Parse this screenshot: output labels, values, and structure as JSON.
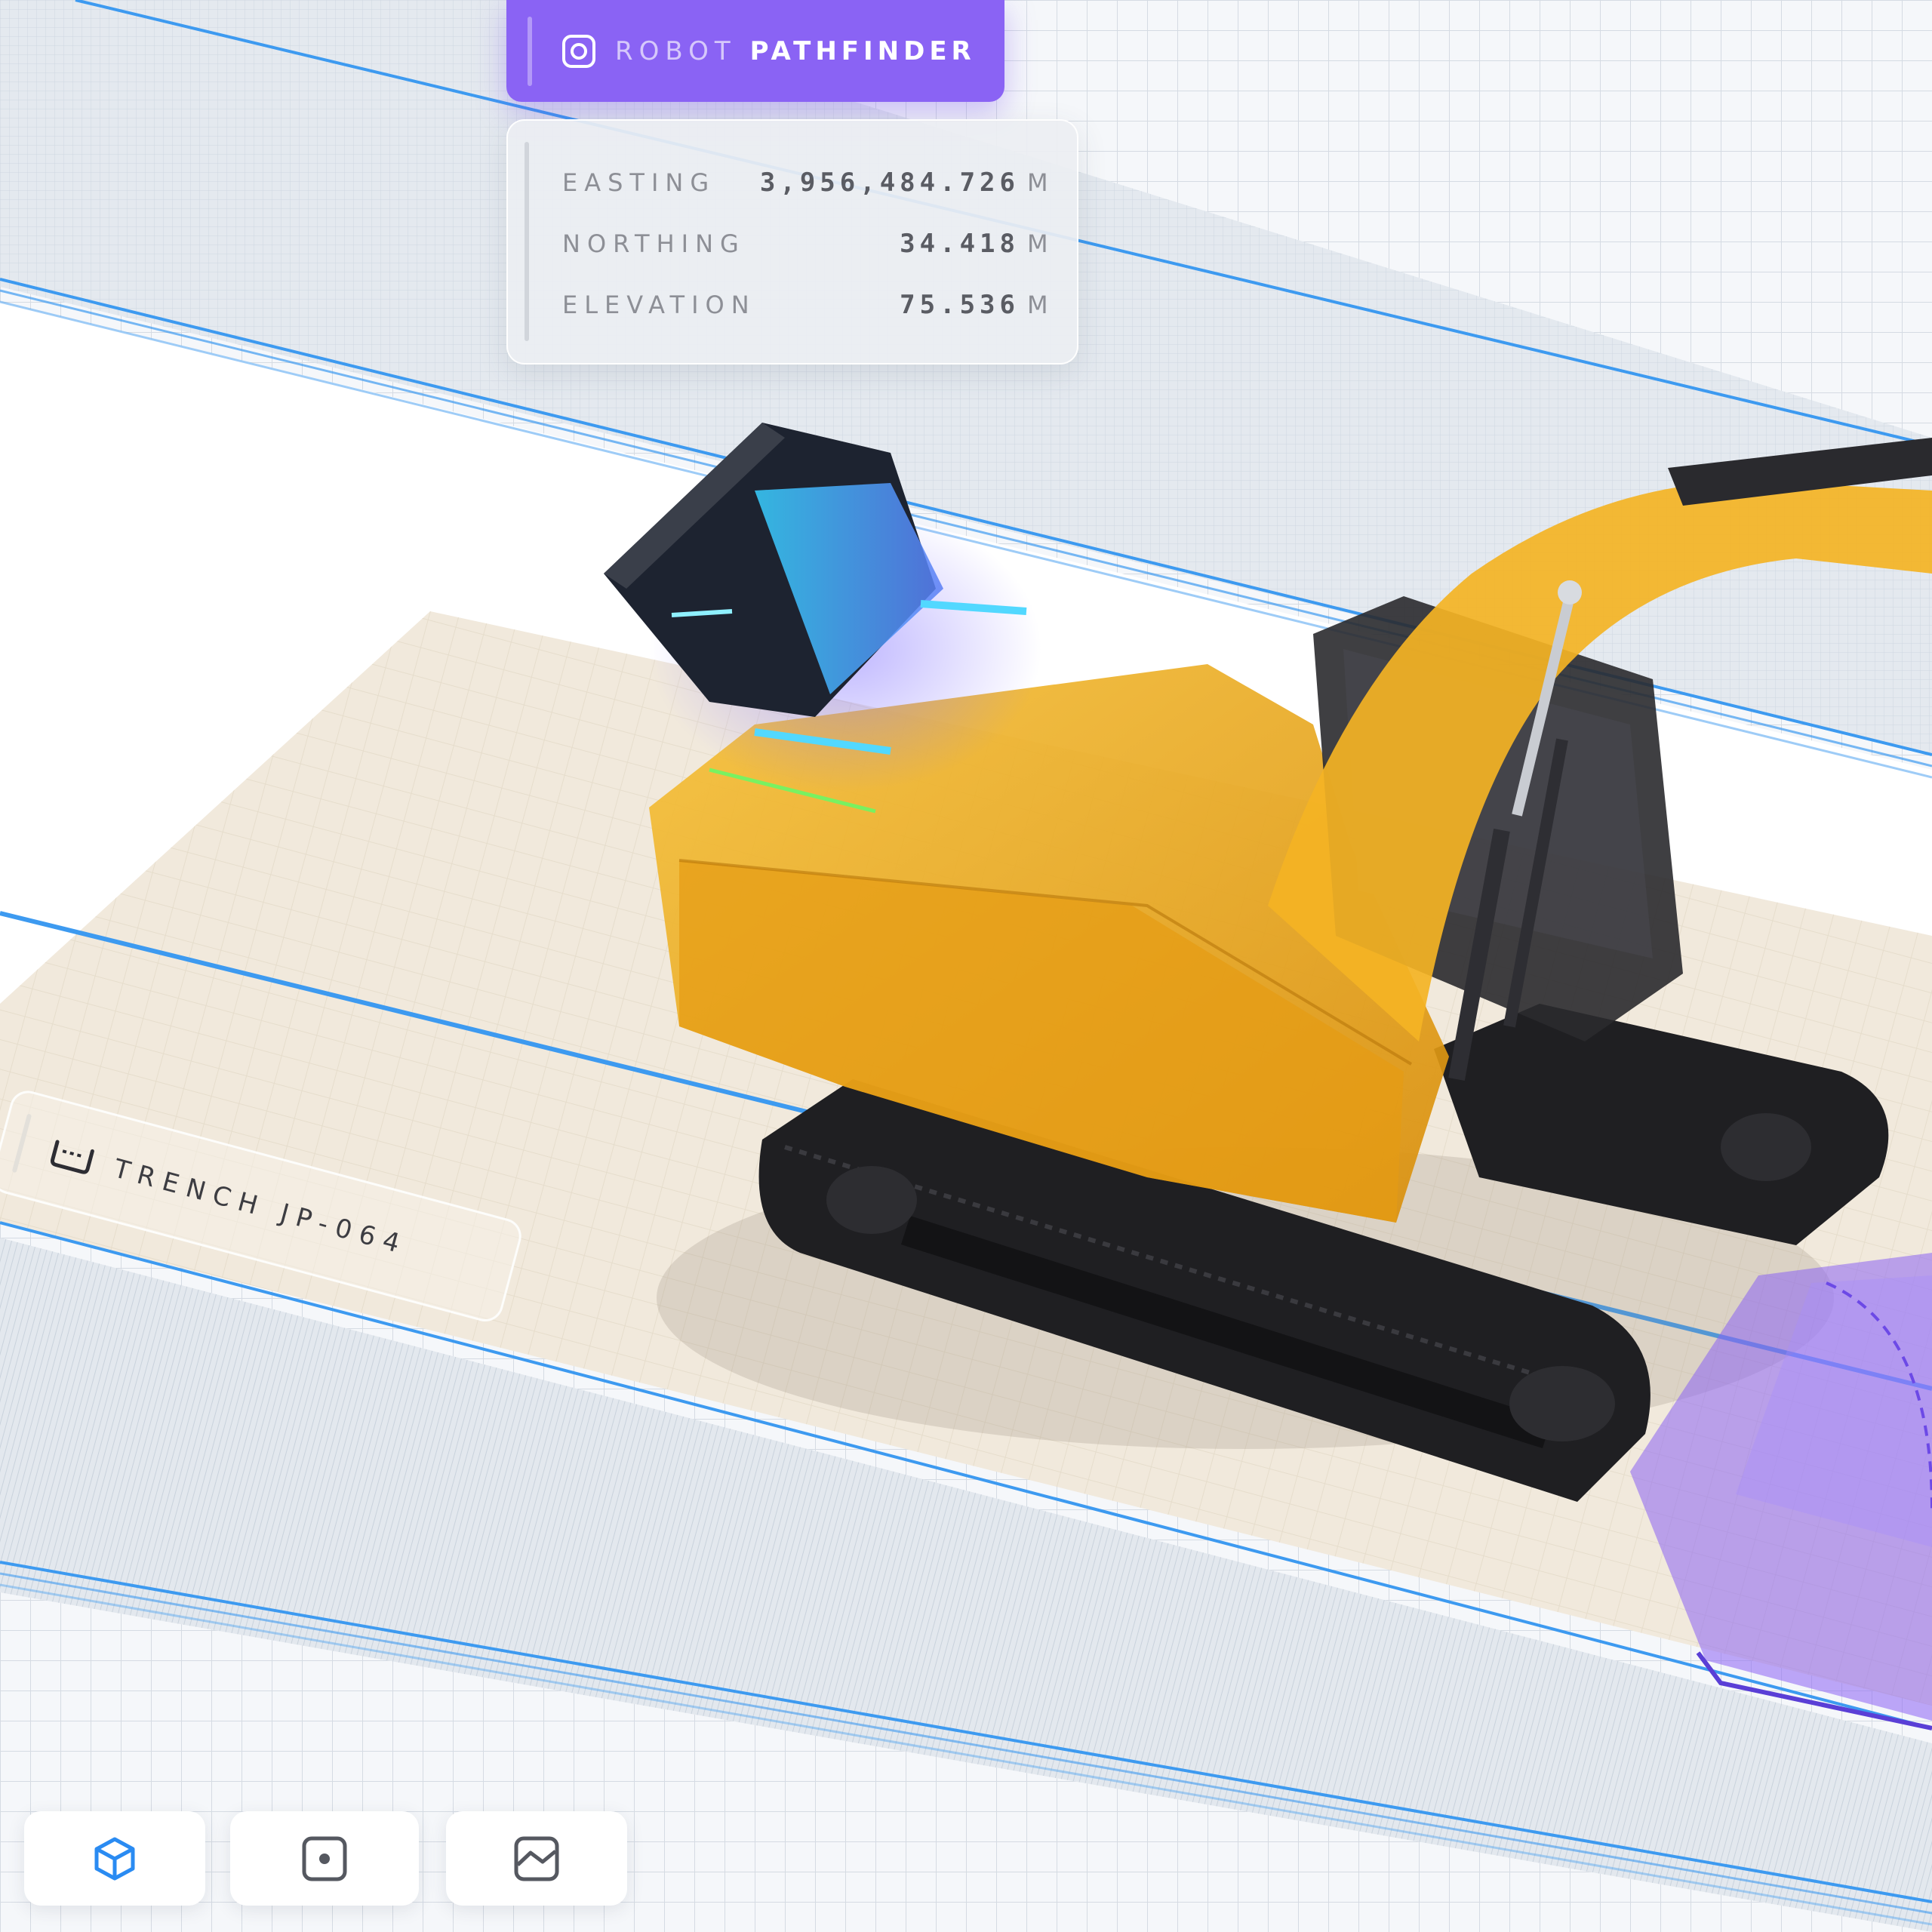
{
  "header": {
    "prefix": "ROBOT",
    "title": "PATHFINDER",
    "icon": "gear-icon"
  },
  "coordinates": [
    {
      "label": "EASTING",
      "value": "3,956,484.726",
      "unit": "M"
    },
    {
      "label": "NORTHING",
      "value": "34.418",
      "unit": "M"
    },
    {
      "label": "ELEVATION",
      "value": "75.536",
      "unit": "M"
    }
  ],
  "trench": {
    "label": "TRENCH JP-064",
    "icon": "trench-icon"
  },
  "toolbar": [
    {
      "icon": "cube-view-icon",
      "active": true
    },
    {
      "icon": "point-view-icon",
      "active": false
    },
    {
      "icon": "terrain-view-icon",
      "active": false
    }
  ],
  "colors": {
    "accent": "#8a63f4",
    "active": "#2a8bf2",
    "excavator": "#f2b01c",
    "lane": "#3d9af0"
  }
}
